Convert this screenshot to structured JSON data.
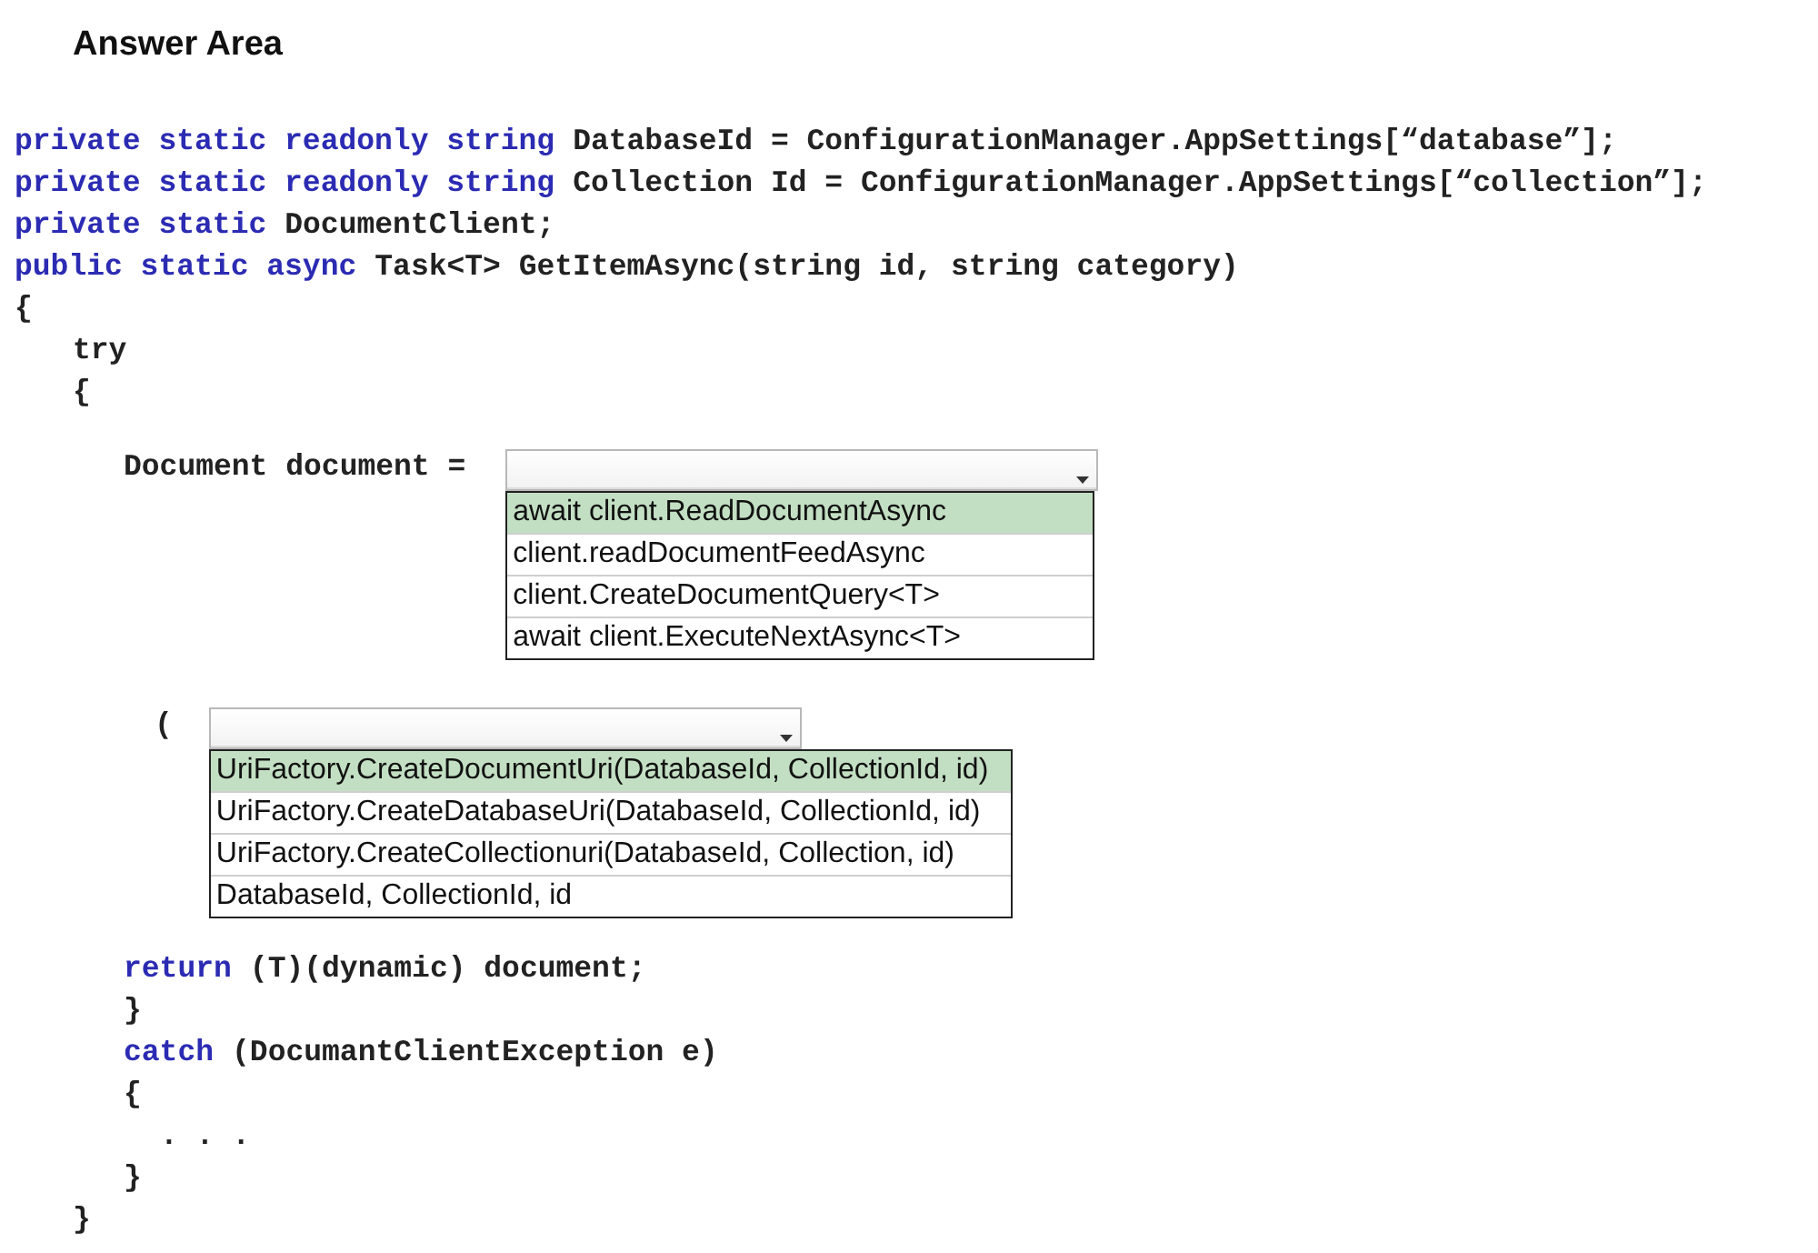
{
  "title": "Answer Area",
  "code": [
    {
      "kind": "line",
      "tokens": [
        {
          "kind": "keyword",
          "text": "private static readonly string"
        },
        {
          "kind": "plain",
          "text": "DatabaseId = ConfigurationManager.AppSettings[“database”];"
        }
      ]
    },
    {
      "kind": "line",
      "tokens": [
        {
          "kind": "keyword",
          "text": "private static readonly string"
        },
        {
          "kind": "plain",
          "text": "Collection Id = ConfigurationManager.AppSettings[“collection”];"
        }
      ]
    },
    {
      "kind": "line",
      "tokens": [
        {
          "kind": "keyword",
          "text": "private static"
        },
        {
          "kind": "plain",
          "text": "DocumentClient;"
        }
      ]
    },
    {
      "kind": "line",
      "tokens": [
        {
          "kind": "keyword",
          "text": "public static async"
        },
        {
          "kind": "plain",
          "text": "Task<T> GetItemAsync(string id, string category)"
        }
      ]
    },
    {
      "kind": "line",
      "tokens": [
        {
          "kind": "plain",
          "text": "{"
        }
      ]
    },
    {
      "kind": "block",
      "children": [
        {
          "kind": "line",
          "tokens": [
            {
              "kind": "plain",
              "text": "try"
            }
          ]
        },
        {
          "kind": "line",
          "tokens": [
            {
              "kind": "plain",
              "text": "{"
            }
          ]
        },
        {
          "kind": "block",
          "children": [
            {
              "kind": "select",
              "label": "Document document =",
              "options": [
                {
                  "text": "await client.ReadDocumentAsync",
                  "selected": true
                },
                {
                  "text": "client.readDocumentFeedAsync",
                  "selected": false
                },
                {
                  "text": "client.CreateDocumentQuery<T>",
                  "selected": false
                },
                {
                  "text": "await client.ExecuteNextAsync<T>",
                  "selected": false
                }
              ]
            },
            {
              "kind": "select",
              "label": "(",
              "options": [
                {
                  "text": "UriFactory.CreateDocumentUri(DatabaseId, CollectionId, id)",
                  "selected": true
                },
                {
                  "text": "UriFactory.CreateDatabaseUri(DatabaseId, CollectionId, id)",
                  "selected": false
                },
                {
                  "text": "UriFactory.CreateCollectionuri(DatabaseId, Collection, id)",
                  "selected": false
                },
                {
                  "text": "DatabaseId, CollectionId, id",
                  "selected": false
                }
              ]
            },
            {
              "kind": "line",
              "tokens": [
                {
                  "kind": "keyword",
                  "text": "return"
                },
                {
                  "kind": "plain",
                  "text": "(T)(dynamic) document;"
                }
              ]
            },
            {
              "kind": "line",
              "tokens": [
                {
                  "kind": "plain",
                  "text": "}"
                }
              ]
            },
            {
              "kind": "line",
              "tokens": [
                {
                  "kind": "keyword",
                  "text": "catch"
                },
                {
                  "kind": "plain",
                  "text": "(DocumantClientException e)"
                }
              ]
            },
            {
              "kind": "line",
              "tokens": [
                {
                  "kind": "plain",
                  "text": "{"
                }
              ]
            },
            {
              "kind": "block",
              "children": [
                {
                  "kind": "line",
                  "tokens": [
                    {
                      "kind": "plain",
                      "text": ". . ."
                    }
                  ]
                }
              ]
            },
            {
              "kind": "line",
              "tokens": [
                {
                  "kind": "plain",
                  "text": "}"
                }
              ]
            }
          ]
        },
        {
          "kind": "line",
          "tokens": [
            {
              "kind": "plain",
              "text": "}"
            }
          ]
        }
      ]
    }
  ]
}
